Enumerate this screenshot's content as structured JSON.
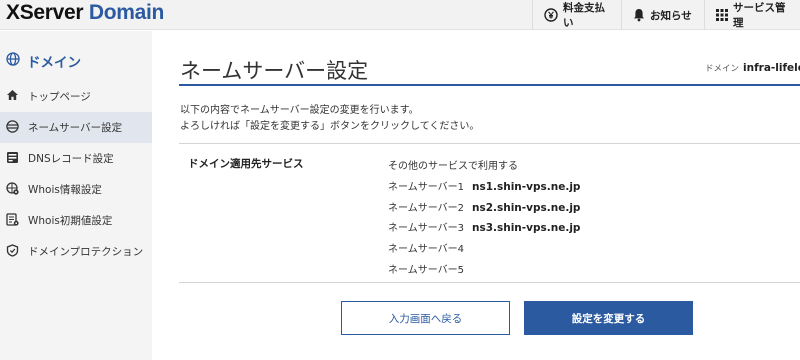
{
  "header": {
    "logo_x": "XServer",
    "logo_domain": "Domain",
    "payment_label": "料金支払い",
    "payment_icon": "yen-circle-icon",
    "notice_label": "お知らせ",
    "notice_icon": "bell-icon",
    "service_label": "サービス管理",
    "service_icon": "grid-icon"
  },
  "sidebar": {
    "title": "ドメイン",
    "title_icon": "globe-icon",
    "items": [
      {
        "label": "トップページ",
        "icon": "home-icon"
      },
      {
        "label": "ネームサーバー設定",
        "icon": "globe-lines-icon",
        "active": true
      },
      {
        "label": "DNSレコード設定",
        "icon": "server-icon"
      },
      {
        "label": "Whois情報設定",
        "icon": "globe-gear-icon"
      },
      {
        "label": "Whois初期値設定",
        "icon": "document-gear-icon"
      },
      {
        "label": "ドメインプロテクション",
        "icon": "shield-icon"
      }
    ]
  },
  "main": {
    "title": "ネームサーバー設定",
    "domain_prefix": "ドメイン",
    "domain_name": "infra-lifelog",
    "description_line1": "以下の内容でネームサーバー設定の変更を行います。",
    "description_line2": "よろしければ「設定を変更する」ボタンをクリックしてください。",
    "service_label": "ドメイン適用先サービス",
    "service_value": "その他のサービスで利用する",
    "nameservers": [
      {
        "label": "ネームサーバー1",
        "value": "ns1.shin-vps.ne.jp"
      },
      {
        "label": "ネームサーバー2",
        "value": "ns2.shin-vps.ne.jp"
      },
      {
        "label": "ネームサーバー3",
        "value": "ns3.shin-vps.ne.jp"
      },
      {
        "label": "ネームサーバー4",
        "value": ""
      },
      {
        "label": "ネームサーバー5",
        "value": ""
      }
    ],
    "back_button": "入力画面へ戻る",
    "submit_button": "設定を変更する"
  },
  "colors": {
    "brand": "#2b5aa0",
    "header_bg": "#f2f2f2",
    "sidebar_bg": "#f4f4f4",
    "active_item_bg": "#e1e6ee"
  }
}
